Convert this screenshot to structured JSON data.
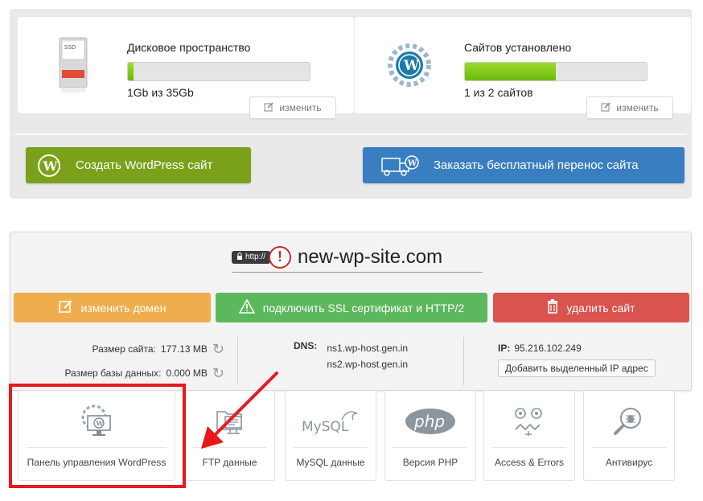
{
  "disk": {
    "title": "Дисковое пространство",
    "value": "1Gb из 35Gb",
    "fill_percent": 3,
    "edit_label": "изменить",
    "icon": "hdd-icon"
  },
  "sites": {
    "title": "Сайтов установлено",
    "value": "1 из 2 сайтов",
    "fill_percent": 50,
    "edit_label": "изменить",
    "icon": "wordpress-gear-icon"
  },
  "actions": {
    "create_wp": "Создать WordPress сайт",
    "transfer": "Заказать бесплатный перенос сайта"
  },
  "site": {
    "http_badge": "http://",
    "domain": "new-wp-site.com",
    "change_domain": "изменить домен",
    "connect_ssl": "подключить SSL сертификат и HTTP/2",
    "delete_site": "удалить сайт",
    "size_label": "Размер сайта:",
    "size_value": "177.13 MB",
    "db_label": "Размер базы данных:",
    "db_value": "0.000 MB",
    "dns_label": "DNS:",
    "dns1": "ns1.wp-host.gen.in",
    "dns2": "ns2.wp-host.gen.in",
    "ip_label": "IP:",
    "ip_value": "95.216.102.249",
    "add_ip": "Добавить выделенный IP адрес"
  },
  "tools": [
    {
      "label": "Панель управления WordPress",
      "icon": "wordpress-admin-icon"
    },
    {
      "label": "FTP данные",
      "icon": "ftp-icon"
    },
    {
      "label": "MySQL данные",
      "icon": "mysql-icon"
    },
    {
      "label": "Версия PHP",
      "icon": "php-icon"
    },
    {
      "label": "Access & Errors",
      "icon": "logs-icon"
    },
    {
      "label": "Антивирус",
      "icon": "antivirus-icon"
    }
  ],
  "colors": {
    "green_button": "#7ba11a",
    "blue_button": "#3a7ec2",
    "orange_button": "#f0ad4e",
    "ssl_button": "#5cb85c",
    "delete_button": "#d9534f",
    "highlight": "#e8191c"
  }
}
